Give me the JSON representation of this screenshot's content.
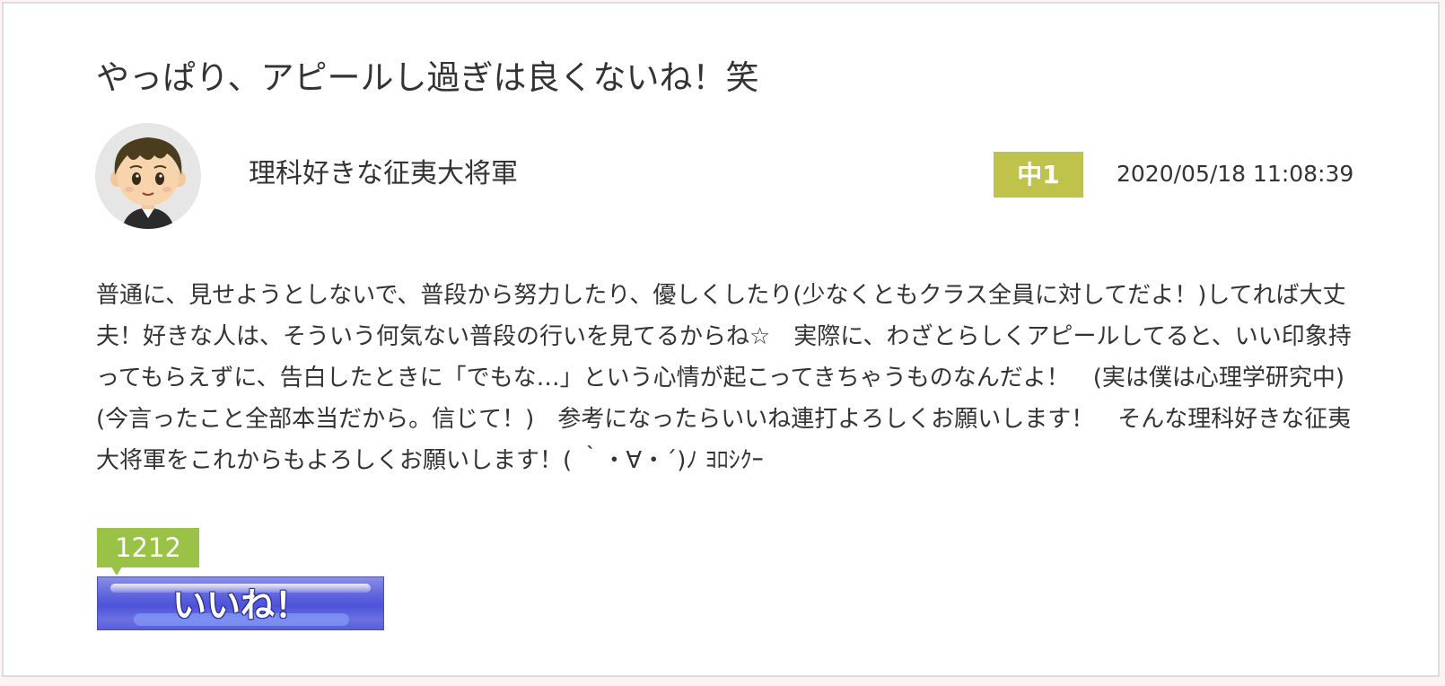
{
  "post": {
    "title": "やっぱり、アピールし過ぎは良くないね！笑",
    "author": "理科好きな征夷大将軍",
    "grade_badge": "中1",
    "datetime": "2020/05/18 11:08:39",
    "body": "普通に、見せようとしないで、普段から努力したり、優しくしたり(少なくともクラス全員に対してだよ！)してれば大丈夫！好きな人は、そういう何気ない普段の行いを見てるからね☆　実際に、わざとらしくアピールしてると、いい印象持ってもらえずに、告白したときに「でもな…」という心情が起こってきちゃうものなんだよ！　(実は僕は心理学研究中)(今言ったこと全部本当だから。信じて！)　参考になったらいいね連打よろしくお願いします！　そんな理科好きな征夷大将軍をこれからもよろしくお願いします！( ｀・∀・´)ﾉ ﾖﾛｼｸｰ"
  },
  "like": {
    "count": "1212",
    "button_label": "いいね！"
  },
  "colors": {
    "grade_badge_bg": "#bfc34c",
    "like_count_bg": "#9ac246",
    "like_button_bg": "#5e64dc",
    "avatar_bg": "#e6e6e6"
  },
  "icons": {
    "avatar": "boy-in-school-uniform-avatar"
  }
}
